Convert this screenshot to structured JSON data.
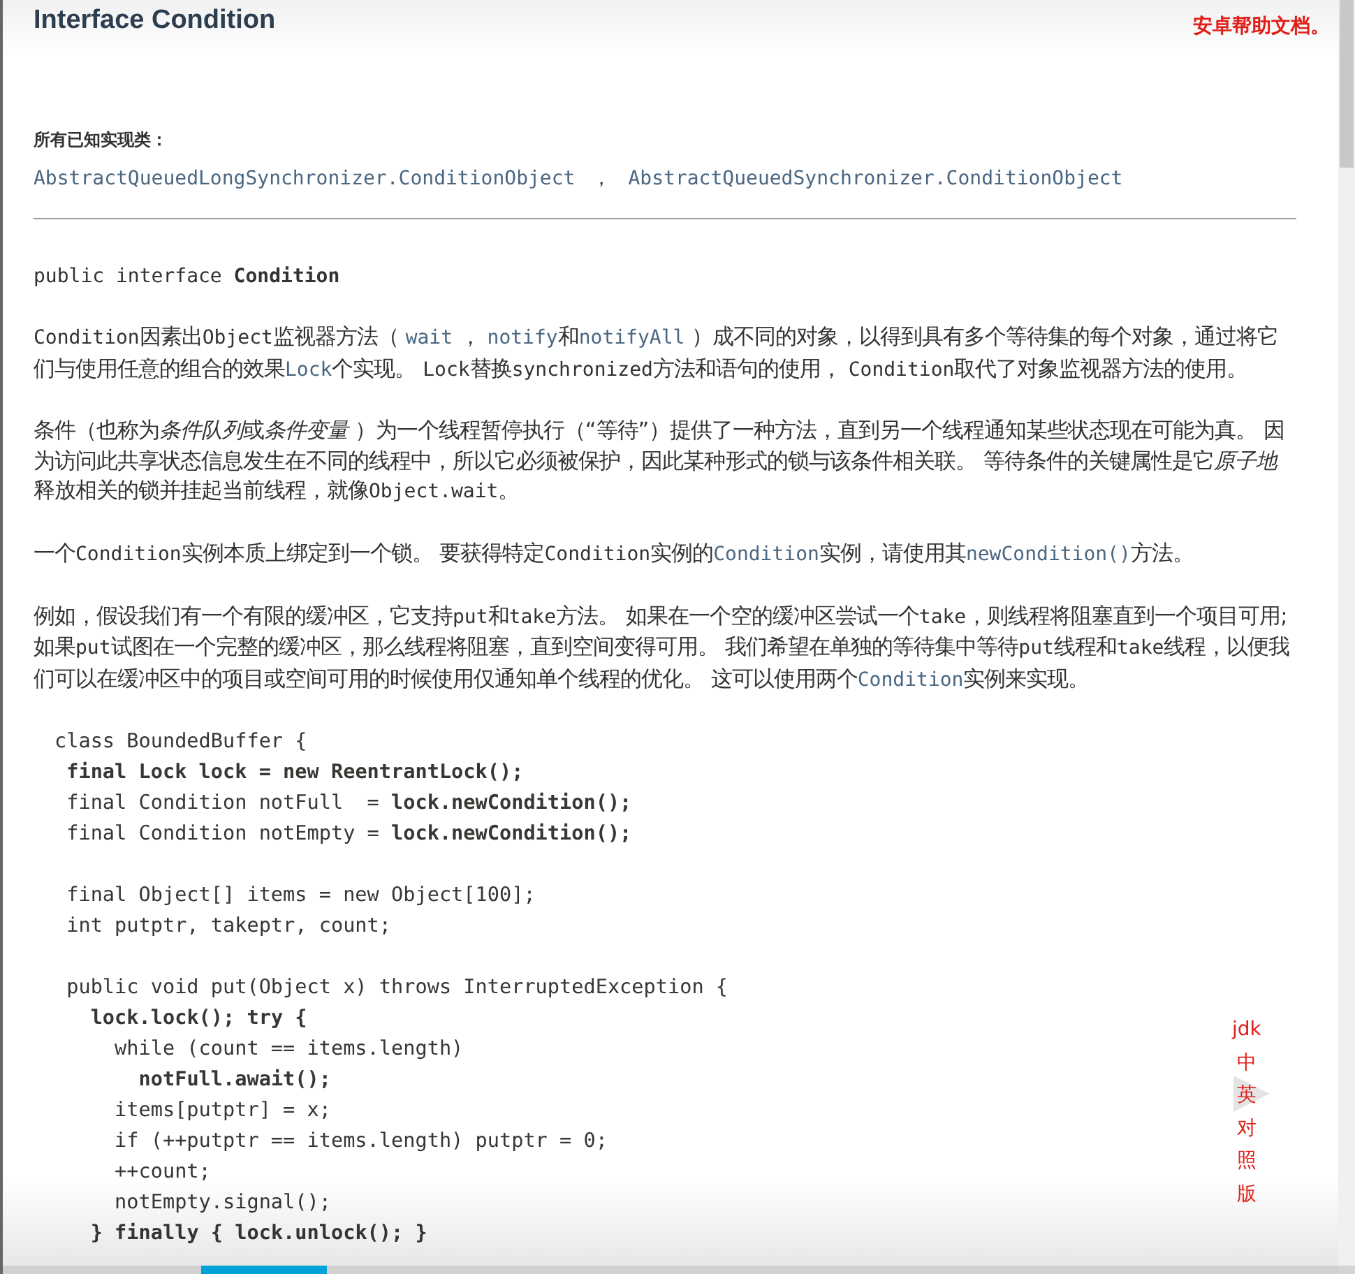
{
  "header": {
    "title": "Interface Condition",
    "annotation": "安卓帮助文档。"
  },
  "implementing": {
    "label": "所有已知实现类：",
    "separator": "，",
    "classes": [
      "AbstractQueuedLongSynchronizer.ConditionObject",
      "AbstractQueuedSynchronizer.ConditionObject"
    ]
  },
  "declaration": "public interface **Condition**",
  "paragraphs": [
    [
      {
        "kind": "code",
        "text": "Condition"
      },
      {
        "kind": "text",
        "text": "因素出"
      },
      {
        "kind": "code",
        "text": "Object"
      },
      {
        "kind": "text",
        "text": "监视器方法（ "
      },
      {
        "kind": "link",
        "text": "wait"
      },
      {
        "kind": "text",
        "text": " ， "
      },
      {
        "kind": "link",
        "text": "notify"
      },
      {
        "kind": "text",
        "text": "和"
      },
      {
        "kind": "link",
        "text": "notifyAll"
      },
      {
        "kind": "text",
        "text": " ）成不同的对象，以得到具有多个等待集的每个对象，通过将它们与使用任意的组合的效果"
      },
      {
        "kind": "link",
        "text": "Lock"
      },
      {
        "kind": "text",
        "text": "个实现。 "
      },
      {
        "kind": "code",
        "text": "Lock"
      },
      {
        "kind": "text",
        "text": "替换"
      },
      {
        "kind": "code",
        "text": "synchronized"
      },
      {
        "kind": "text",
        "text": "方法和语句的使用， "
      },
      {
        "kind": "code",
        "text": "Condition"
      },
      {
        "kind": "text",
        "text": "取代了对象监视器方法的使用。"
      }
    ],
    [
      {
        "kind": "text",
        "text": "条件（也称为"
      },
      {
        "kind": "italic",
        "text": "条件队列"
      },
      {
        "kind": "text",
        "text": "或"
      },
      {
        "kind": "italic",
        "text": "条件变量"
      },
      {
        "kind": "text",
        "text": " ）为一个线程暂停执行（“等待”）提供了一种方法，直到另一个线程通知某些状态现在可能为真。 因为访问此共享状态信息发生在不同的线程中，所以它必须被保护，因此某种形式的锁与该条件相关联。 等待条件的关键属性是它"
      },
      {
        "kind": "italic",
        "text": "原子地"
      },
      {
        "kind": "text",
        "text": "释放相关的锁并挂起当前线程，就像"
      },
      {
        "kind": "code",
        "text": "Object.wait"
      },
      {
        "kind": "text",
        "text": "。"
      }
    ],
    [
      {
        "kind": "text",
        "text": "一个"
      },
      {
        "kind": "code",
        "text": "Condition"
      },
      {
        "kind": "text",
        "text": "实例本质上绑定到一个锁。 要获得特定"
      },
      {
        "kind": "code",
        "text": "Condition"
      },
      {
        "kind": "text",
        "text": "实例的"
      },
      {
        "kind": "link",
        "text": "Condition"
      },
      {
        "kind": "text",
        "text": "实例，请使用其"
      },
      {
        "kind": "link",
        "text": "newCondition()"
      },
      {
        "kind": "text",
        "text": "方法。"
      }
    ],
    [
      {
        "kind": "text",
        "text": "例如，假设我们有一个有限的缓冲区，它支持"
      },
      {
        "kind": "code",
        "text": "put"
      },
      {
        "kind": "text",
        "text": "和"
      },
      {
        "kind": "code",
        "text": "take"
      },
      {
        "kind": "text",
        "text": "方法。 如果在一个空的缓冲区尝试一个"
      },
      {
        "kind": "code",
        "text": "take"
      },
      {
        "kind": "text",
        "text": "，则线程将阻塞直到一个项目可用; 如果"
      },
      {
        "kind": "code",
        "text": "put"
      },
      {
        "kind": "text",
        "text": "试图在一个完整的缓冲区，那么线程将阻塞，直到空间变得可用。 我们希望在单独的等待集中等待"
      },
      {
        "kind": "code",
        "text": "put"
      },
      {
        "kind": "text",
        "text": "线程和"
      },
      {
        "kind": "code",
        "text": "take"
      },
      {
        "kind": "text",
        "text": "线程，以便我们可以在缓冲区中的项目或空间可用的时候使用仅通知单个线程的优化。 这可以使用两个"
      },
      {
        "kind": "link",
        "text": "Condition"
      },
      {
        "kind": "text",
        "text": "实例来实现。"
      }
    ]
  ],
  "code_blocks": [
    [
      "class BoundedBuffer {",
      " **final Lock lock = new ReentrantLock();**",
      " final Condition notFull  = **lock.newCondition();**",
      " final Condition notEmpty = **lock.newCondition();**"
    ],
    [
      " final Object[] items = new Object[100];",
      " int putptr, takeptr, count;"
    ],
    [
      " public void put(Object x) throws InterruptedException {",
      "   **lock.lock(); try {**",
      "     while (count == items.length)",
      "       **notFull.await();**",
      "     items[putptr] = x;",
      "     if (++putptr == items.length) putptr = 0;",
      "     ++count;",
      "     notEmpty.signal();",
      "   **} finally { lock.unlock(); }**"
    ]
  ],
  "video_progress": {
    "level": 0.24
  },
  "side_note": [
    "jdk",
    "中",
    "英",
    "对",
    "照",
    "版"
  ]
}
